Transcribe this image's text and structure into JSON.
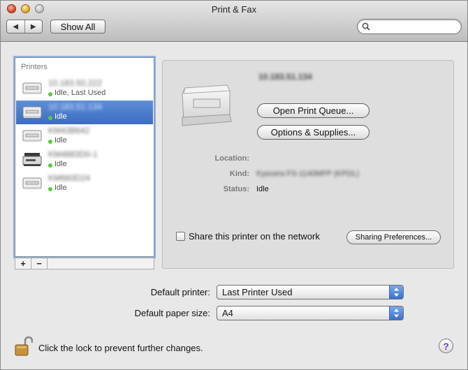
{
  "window": {
    "title": "Print & Fax"
  },
  "toolbar": {
    "back_glyph": "◀",
    "forward_glyph": "▶",
    "show_all_label": "Show All",
    "search_placeholder": ""
  },
  "printers": {
    "header": "Printers",
    "items": [
      {
        "name": "10.183.50.222",
        "status": "Idle, Last Used",
        "icon": "laser-printer-icon",
        "selected": false
      },
      {
        "name": "10.183.51.134",
        "status": "Idle",
        "icon": "laser-printer-icon",
        "selected": true
      },
      {
        "name": "KM43B642",
        "status": "Idle",
        "icon": "laser-printer-icon",
        "selected": false
      },
      {
        "name": "KM4883D0-1",
        "status": "Idle",
        "icon": "mfp-printer-icon",
        "selected": false
      },
      {
        "name": "KM660D24",
        "status": "Idle",
        "icon": "laser-printer-icon",
        "selected": false
      }
    ],
    "add_label": "+",
    "remove_label": "−"
  },
  "detail": {
    "printer_name": "10.183.51.134",
    "open_queue_label": "Open Print Queue...",
    "options_label": "Options & Supplies...",
    "location_label": "Location:",
    "location_value": "",
    "kind_label": "Kind:",
    "kind_value": "Kyocera FS-1140MFP (KPDL)",
    "status_label": "Status:",
    "status_value": "Idle",
    "share_label": "Share this printer on the network",
    "sharing_prefs_label": "Sharing Preferences..."
  },
  "defaults": {
    "printer_label": "Default printer:",
    "printer_value": "Last Printer Used",
    "paper_label": "Default paper size:",
    "paper_value": "A4"
  },
  "footer": {
    "lock_text": "Click the lock to prevent further changes.",
    "help_label": "?"
  },
  "colors": {
    "selection": "#3b6dc0",
    "status_dot": "#5ec93c",
    "popup_arrow": "#3a6fd0"
  }
}
